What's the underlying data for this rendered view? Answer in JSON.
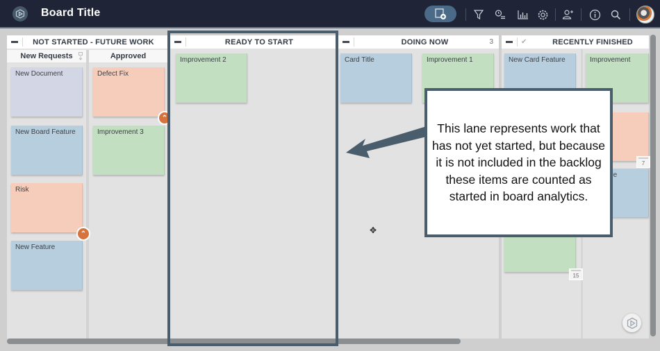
{
  "header": {
    "board_title": "Board Title",
    "icons": {
      "logo": "leankit-hex-play-icon",
      "add_card": "add-card-icon",
      "filter": "filter-icon",
      "timer": "timer-list-icon",
      "analytics": "bar-chart-icon",
      "settings": "gear-icon",
      "add_user": "add-user-icon",
      "info": "info-icon",
      "search": "search-icon"
    }
  },
  "lanes": {
    "not_started": {
      "title": "NOT STARTED - FUTURE WORK",
      "sublanes": [
        {
          "title": "New Requests",
          "cards": [
            {
              "title": "New Document",
              "color": "#d3d6e4"
            },
            {
              "title": "New Board Feature",
              "color": "#b7cedf"
            },
            {
              "title": "Risk",
              "color": "#f6cdbb",
              "blocked": true
            },
            {
              "title": "New Feature",
              "color": "#b7cedf"
            }
          ]
        },
        {
          "title": "Approved",
          "cards": [
            {
              "title": "Defect Fix",
              "color": "#f6cdbb",
              "blocked": true
            },
            {
              "title": "Improvement 3",
              "color": "#c2dfc2"
            }
          ]
        }
      ]
    },
    "ready_to_start": {
      "title": "READY TO START",
      "cards": [
        {
          "title": "Improvement 2",
          "color": "#c2dfc2"
        }
      ]
    },
    "doing_now": {
      "title": "DOING NOW",
      "count": "3",
      "cards": [
        {
          "title": "Card Title",
          "color": "#b7cedf"
        },
        {
          "title": "Improvement 1",
          "color": "#c2dfc2"
        }
      ]
    },
    "recently_finished": {
      "title": "RECENTLY FINISHED",
      "check": "✔",
      "cards": [
        {
          "title": "New Card Feature",
          "color": "#b7cedf"
        },
        {
          "title": "Improvement",
          "color": "#c2dfc2"
        },
        {
          "title": "",
          "color": "#f6cdbb",
          "date": "7"
        },
        {
          "title": "rd Feature",
          "color": "#b7cedf"
        },
        {
          "title": "",
          "color": "#c2dfc2",
          "date": "15"
        }
      ]
    }
  },
  "callout": {
    "text": "This lane represents work that has not yet started, but because it is not included in the backlog these items are counted as started in board analytics."
  },
  "colors": {
    "topbar": "#1f2436",
    "highlight": "#4a5d6c",
    "blocker": "#d5723e",
    "blue_card": "#b7cedf",
    "green_card": "#c2dfc2",
    "salmon_card": "#f6cdbb",
    "lavender_card": "#d3d6e4"
  }
}
